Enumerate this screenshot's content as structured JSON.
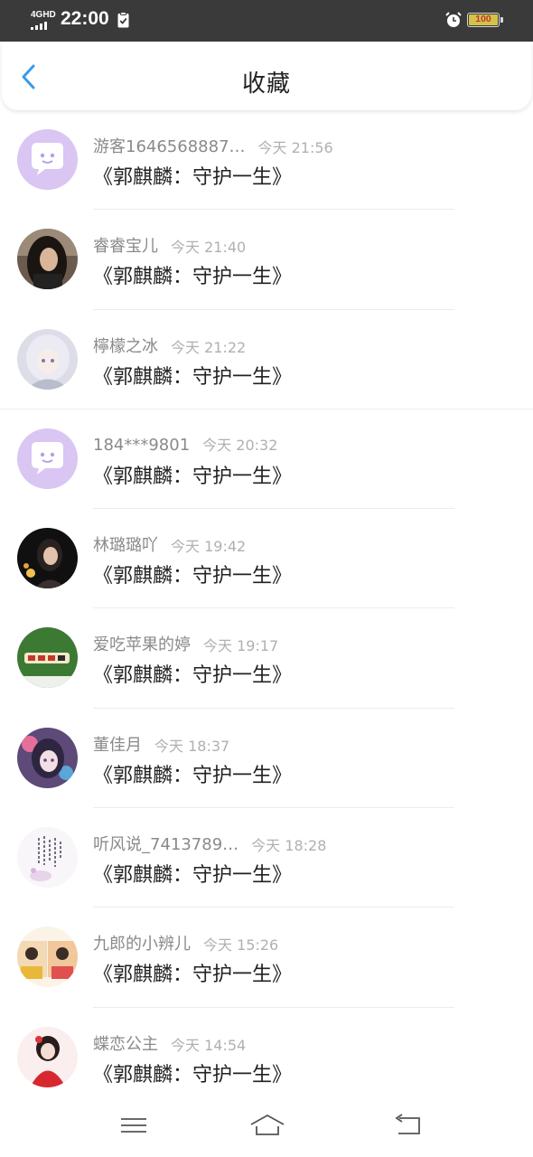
{
  "status_bar": {
    "network": "4GHD",
    "time": "22:00",
    "battery": "100",
    "icons": [
      "signal-icon",
      "clipboard-icon",
      "alarm-icon",
      "battery-icon"
    ],
    "battery_color": "#d4c24a"
  },
  "header": {
    "title": "收藏",
    "back_icon": "chevron-left-icon",
    "accent": "#3a9be8"
  },
  "items": [
    {
      "user": "游客1646568887…",
      "time": "今天 21:56",
      "title": "《郭麒麟：守护一生》",
      "avatar": "default-chat-avatar"
    },
    {
      "user": "睿睿宝儿",
      "time": "今天 21:40",
      "title": "《郭麒麟：守护一生》",
      "avatar": "photo-avatar"
    },
    {
      "user": "檸檬之冰",
      "time": "今天 21:22",
      "title": "《郭麒麟：守护一生》",
      "avatar": "anime-avatar"
    },
    {
      "user": "184***9801",
      "time": "今天 20:32",
      "title": "《郭麒麟：守护一生》",
      "avatar": "default-chat-avatar"
    },
    {
      "user": "林璐璐吖",
      "time": "今天 19:42",
      "title": "《郭麒麟：守护一生》",
      "avatar": "photo-avatar"
    },
    {
      "user": "爱吃苹果的婷",
      "time": "今天 19:17",
      "title": "《郭麒麟：守护一生》",
      "avatar": "green-sticker-avatar"
    },
    {
      "user": "董佳月",
      "time": "今天 18:37",
      "title": "《郭麒麟：守护一生》",
      "avatar": "anime-avatar"
    },
    {
      "user": "听风说_7413789…",
      "time": "今天 18:28",
      "title": "《郭麒麟：守护一生》",
      "avatar": "calligraphy-avatar"
    },
    {
      "user": "九郎的小辨儿",
      "time": "今天 15:26",
      "title": "《郭麒麟：守护一生》",
      "avatar": "photo-avatar"
    },
    {
      "user": "蝶恋公主",
      "time": "今天 14:54",
      "title": "《郭麒麟：守护一生》",
      "avatar": "costume-avatar"
    }
  ],
  "nav_bar": {
    "buttons": [
      "menu-icon",
      "home-icon",
      "back-icon"
    ]
  }
}
